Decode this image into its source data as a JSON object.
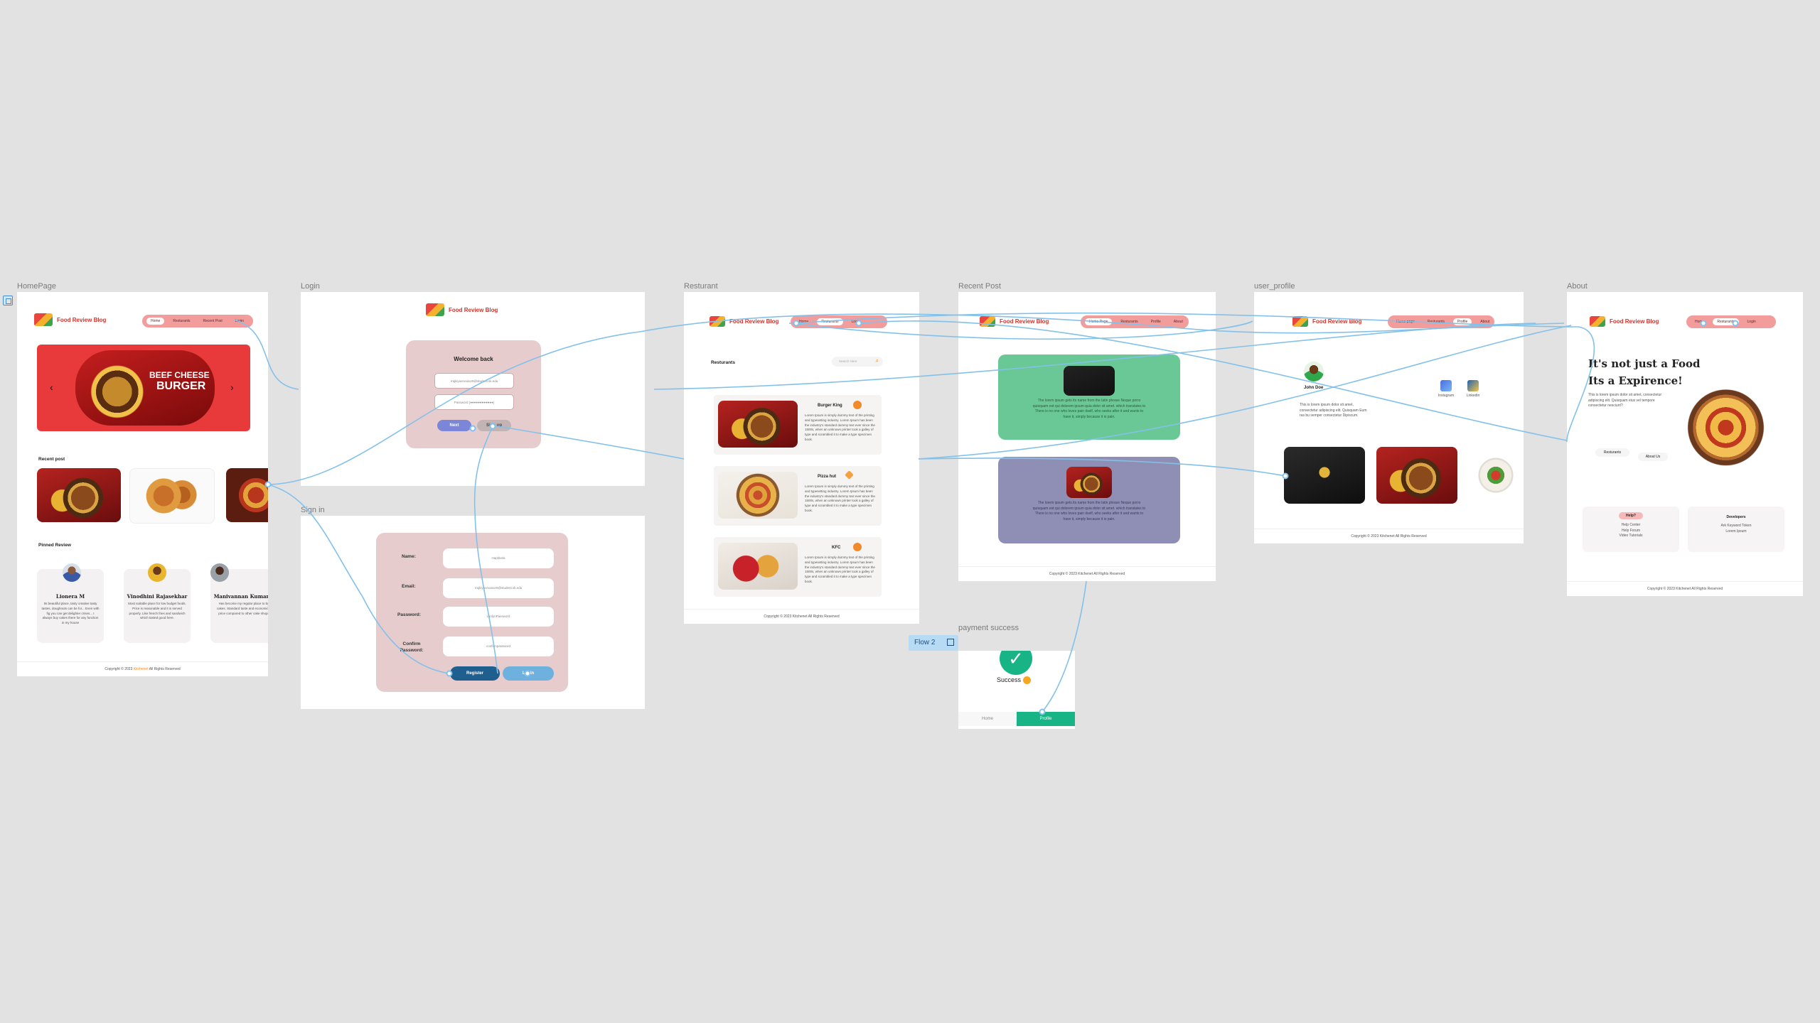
{
  "colors": {
    "canvas": "#e2e2e2",
    "brand_red": "#d6322a",
    "nav_pink": "#f29c9c",
    "flow_blue": "#84c1ea",
    "login_card": "#e6cccc",
    "success_green": "#16b38a"
  },
  "frames": {
    "home": "HomePage",
    "login": "Login",
    "signin": "Sign in",
    "restaurant": "Resturant",
    "recent": "Recent Post",
    "profile": "user_profile",
    "about": "About",
    "payment": "payment success"
  },
  "flow": {
    "label": "Flow 2",
    "icon": "flow-play-icon"
  },
  "brand": {
    "name": "Food Review Blog"
  },
  "home": {
    "nav": [
      "Home",
      "Resturants",
      "Recent Post",
      "Login"
    ],
    "banner": {
      "line1": "BEEF CHEESE",
      "line2": "BURGER"
    },
    "recent_heading": "Recent post",
    "pinned_heading": "Pinned Review",
    "reviewers": [
      {
        "name": "Lionera M",
        "text": "Its beautiful place, tasty creative tasty tastes, doughnuts can be for... Even with fig you can get delighter crises... I always buy cakes there for any function in my house"
      },
      {
        "name": "Vinodhini Rajasekhar",
        "text": "Most suitable place for low budget foods. Price is reasonable and it is served properly. Like french fries and sandwich which tasted good here."
      },
      {
        "name": "Manivannan Kumaraj",
        "text": "Has become my regular place to by cakes. Standard taste and economical price compared to other cake shops"
      }
    ],
    "footer": {
      "prefix": "Copyright © 2023",
      "brand": "Kitchenet",
      "suffix": "All Rights Reserved"
    }
  },
  "login": {
    "title": "Welcome back",
    "email_value": "rrajkiyasrvaisor9@student.sk.edu",
    "password_value": "Password (●●●●●●●●●●●●)",
    "next_label": "Next",
    "other_label": "Sign up"
  },
  "signin": {
    "name_label": "Name:",
    "email_label": "Email:",
    "password_label": "Password:",
    "confirm_label": "Confirm Password:",
    "name_value": "Haphkela",
    "email_value": "rrajkiyasrvaisor9@student.sk.edu",
    "password_value": "vanlynPassword",
    "confirm_value": "confirmpassword",
    "register_label": "Register",
    "login_label": "Login"
  },
  "restaurant": {
    "nav": [
      "Home",
      "Resturants",
      "Login"
    ],
    "heading": "Resturants",
    "search_placeholder": "Search Here",
    "items": [
      {
        "name": "Burger King",
        "text": "Lorem Ipsum is simply dummy text of the printing and typesetting industry. Lorem Ipsum has been the industry's standard dummy text ever since the 1500s, when an unknown printer took a galley of type and scrambled it to make a type specimen book."
      },
      {
        "name": "Pizza hut",
        "text": "Lorem Ipsum is simply dummy text of the printing and typesetting industry. Lorem Ipsum has been the industry's standard dummy text ever since the 1500s, when an unknown printer took a galley of type and scrambled it to make a type specimen book."
      },
      {
        "name": "KFC",
        "text": "Lorem Ipsum is simply dummy text of the printing and typesetting industry. Lorem Ipsum has been the industry's standard dummy text ever since the 1500s, when an unknown printer took a galley of type and scrambled it to make a type specimen book."
      }
    ],
    "footer": "Copyright © 2023 Kitchenet All Rights Reserved"
  },
  "recent": {
    "nav": [
      "Home Page",
      "Resturants",
      "Profile",
      "About"
    ],
    "posts": [
      "The lorem ipsum gets its name from the latin phrase Neque porro quisquam est qui dolorem ipsum quia dolor sit amet. which translates to There is no one who loves pain itself, who seeks after it and wants to have it, simply because it is pain.",
      "The lorem ipsum gets its name from the latin phrase Neque porro quisquam est qui dolorem ipsum quia dolor sit amet. which translates to There is no one who loves pain itself, who seeks after it and wants to have it, simply because it is pain."
    ],
    "footer": "Copyright © 2023 Kitchenet All Rights Reserved"
  },
  "profile": {
    "nav": [
      "Home page",
      "Resturants",
      "Profile",
      "About"
    ],
    "user": "John Doe",
    "bio": "This is lorem ipsum dolor sit amet, consectetur adipiscing elit. Quisquam Eum ras bu semper consectetur Dipiscum.",
    "apps": [
      "Instagram",
      "Linkedin"
    ],
    "footer": "Copyright © 2023 Kitchenet All Rights Reserved"
  },
  "about": {
    "nav": [
      "Home",
      "Resturants",
      "Login"
    ],
    "headline1": "It's not just a Food",
    "headline2": "Its a Expirence!",
    "text": "This is lorem ipsum dolor sit amet, consectetur adipiscing elit. Quisquam eius vel tempore consectetur nesciunt?",
    "btn1": "Resturants",
    "btn2": "About Us",
    "help_title": "Help?",
    "help_items": [
      "Help Center",
      "Help Forum",
      "Video Tutorials"
    ],
    "dev_title": "Developers",
    "dev_items": [
      "Ark Keyword Token",
      "Lorem Ipsum"
    ],
    "footer": "Copyright © 2023 Kitchenet All Rights Reserved"
  },
  "payment": {
    "status": "Success",
    "home_label": "Home",
    "profile_label": "Profile"
  }
}
